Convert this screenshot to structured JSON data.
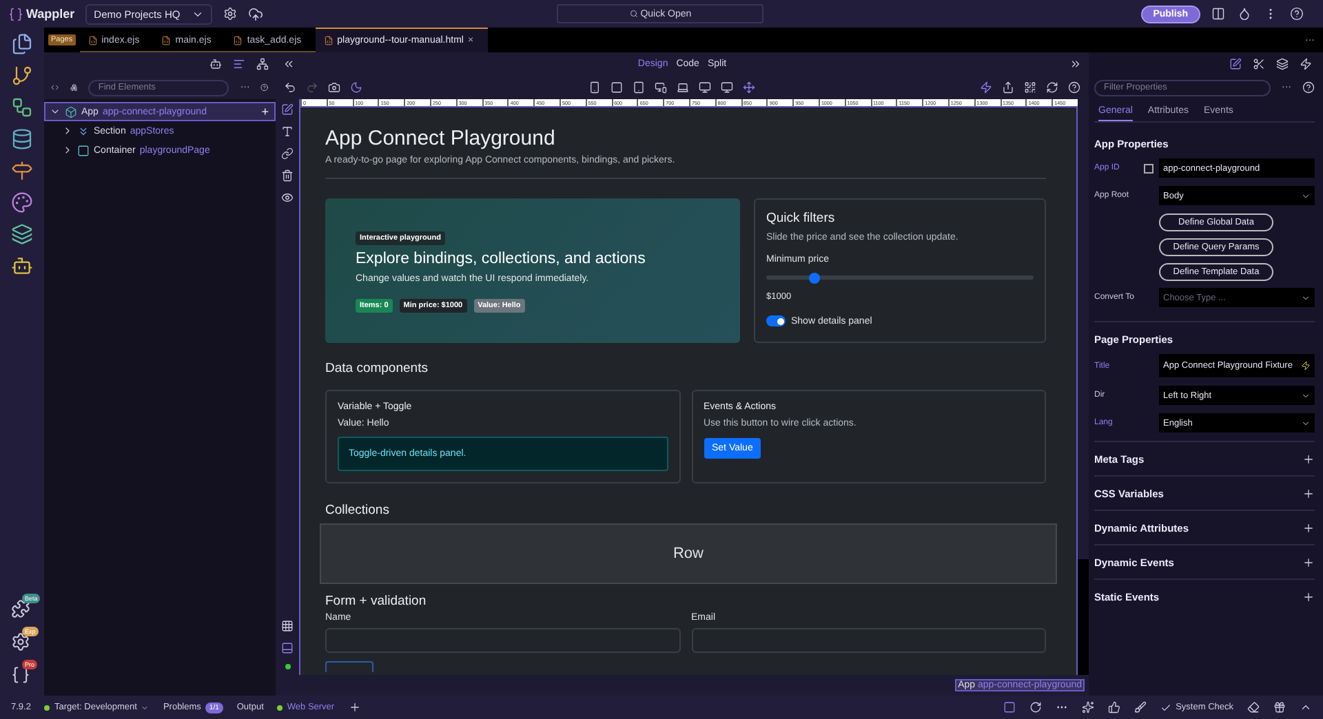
{
  "app": {
    "name": "Wappler",
    "project": "Demo Projects HQ",
    "quick_open": "Quick Open",
    "publish": "Publish"
  },
  "rail_badges": [
    {
      "badge": "Beta",
      "color": "#3f8f8c"
    },
    {
      "badge": "Exp",
      "color": "#d9a55a"
    },
    {
      "badge": "Pro",
      "color": "#c23b3b"
    }
  ],
  "file_tabs": {
    "group": "Pages",
    "overflow": "···",
    "tabs": [
      {
        "label": "index.ejs",
        "selected": false
      },
      {
        "label": "main.ejs",
        "selected": false
      },
      {
        "label": "task_add.ejs",
        "selected": false
      },
      {
        "label": "playground--tour-manual.html",
        "selected": true
      }
    ],
    "close": "×"
  },
  "structure": {
    "search_placeholder": "Find Elements",
    "more": "···",
    "add": "+",
    "tree": [
      {
        "kind": "app",
        "type": "App",
        "name": "app-connect-playground",
        "expanded": true,
        "selected": true,
        "children": [
          {
            "kind": "section",
            "type": "Section",
            "name": "appStores",
            "expanded": false,
            "selected": false
          },
          {
            "kind": "container",
            "type": "Container",
            "name": "playgroundPage",
            "expanded": false,
            "selected": false
          }
        ]
      }
    ]
  },
  "view_modes": [
    {
      "label": "Design",
      "selected": true
    },
    {
      "label": "Code",
      "selected": false
    },
    {
      "label": "Split",
      "selected": false
    }
  ],
  "ruler": [
    "0",
    "50",
    "100",
    "150",
    "200",
    "250",
    "300",
    "350",
    "400",
    "450",
    "500",
    "550",
    "600",
    "650",
    "700",
    "750",
    "800",
    "850",
    "900",
    "950",
    "1000",
    "1050",
    "1100",
    "1150",
    "1200",
    "1250",
    "1300",
    "1350",
    "1400",
    "1450"
  ],
  "page": {
    "title": "App Connect Playground",
    "subtitle": "A ready-to-go page for exploring App Connect components, bindings, and pickers.",
    "hero": {
      "badge": "Interactive playground",
      "heading": "Explore bindings, collections, and actions",
      "text": "Change values and watch the UI respond immediately.",
      "pills": [
        {
          "label": "Items: 0",
          "color": "#198754"
        },
        {
          "label": "Min price: $1000",
          "color": "#212529"
        },
        {
          "label": "Value: Hello",
          "color": "#6c757d"
        }
      ]
    },
    "filters": {
      "title": "Quick filters",
      "text": "Slide the price and see the collection update.",
      "slider_label": "Minimum price",
      "level": 0.18,
      "reading": "$1000",
      "toggle": {
        "label": "Show details panel",
        "on": true
      }
    },
    "data_heading": "Data components",
    "variable_card": {
      "title": "Variable + Toggle",
      "value": "Value: Hello",
      "panel": "Toggle-driven details panel."
    },
    "events_card": {
      "title": "Events & Actions",
      "text": "Use this button to wire click actions.",
      "button": "Set Value"
    },
    "collections_heading": "Collections",
    "row_overlay": "Row",
    "form": {
      "heading": "Form + validation",
      "fields": [
        {
          "label": "Name"
        },
        {
          "label": "Email"
        }
      ]
    }
  },
  "breadcrumb": {
    "type": "App",
    "name": "app-connect-playground"
  },
  "properties": {
    "filter_placeholder": "Filter Properties",
    "more": "···",
    "tabs": [
      {
        "label": "General",
        "selected": true
      },
      {
        "label": "Attributes",
        "selected": false
      },
      {
        "label": "Events",
        "selected": false
      }
    ],
    "app_section": {
      "title": "App Properties",
      "rows": [
        {
          "label": "App ID",
          "value": "app-connect-playground",
          "kind": "text",
          "highlighted": true
        },
        {
          "label": "App Root",
          "value": "Body",
          "kind": "select",
          "highlighted": false
        }
      ],
      "buttons": [
        "Define Global Data",
        "Define Query Params",
        "Define Template Data"
      ],
      "convert": {
        "label": "Convert To",
        "placeholder": "Choose Type ..."
      }
    },
    "page_section": {
      "title": "Page Properties",
      "rows": [
        {
          "label": "Title",
          "value": "App Connect Playground Fixture",
          "kind": "dynamic",
          "highlighted": true
        },
        {
          "label": "Dir",
          "value": "Left to Right",
          "kind": "select",
          "highlighted": false
        },
        {
          "label": "Lang",
          "value": "English",
          "kind": "select",
          "highlighted": true
        }
      ]
    },
    "collapsed_sections": [
      "Meta Tags",
      "CSS Variables",
      "Dynamic Attributes",
      "Dynamic Events",
      "Static Events"
    ]
  },
  "status_bar": {
    "version": "7.9.2",
    "target": "Target: Development",
    "problems": "Problems",
    "problems_count": "1/1",
    "output": "Output",
    "server": "Web Server",
    "system_check": "System Check"
  }
}
